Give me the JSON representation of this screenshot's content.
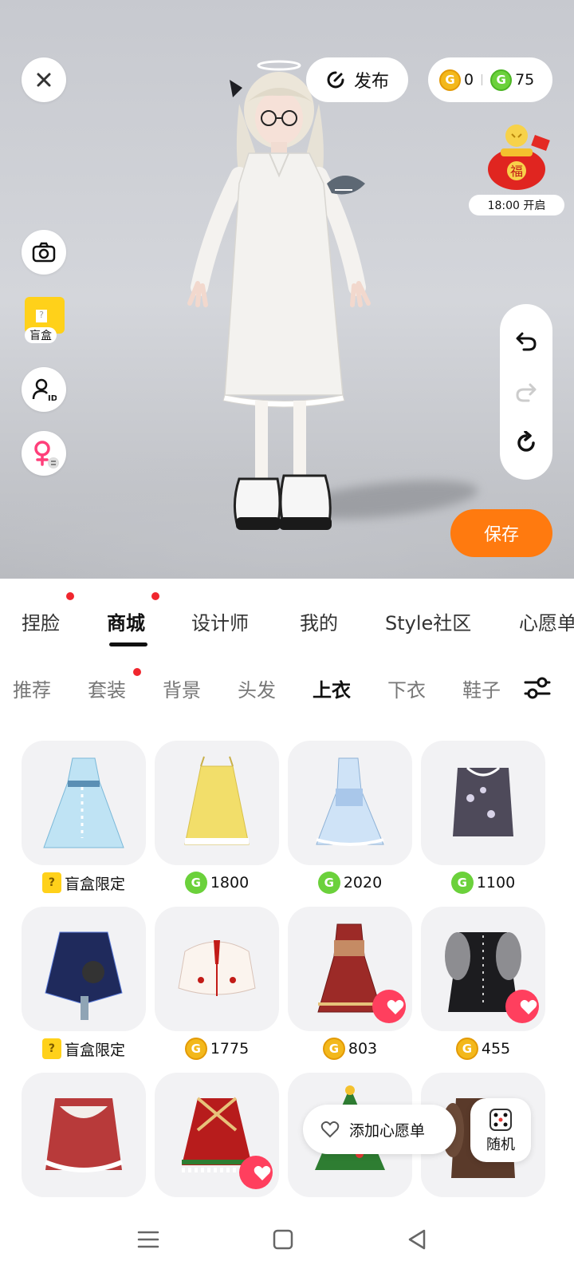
{
  "top": {
    "publish_label": "发布",
    "wallet": {
      "gold_coins": "0",
      "green_coins": "75"
    },
    "event_time": "18:00 开启",
    "blind_box_label": "盲盒",
    "save_label": "保存"
  },
  "main_tabs": [
    {
      "label": "捏脸",
      "dot": true
    },
    {
      "label": "商城",
      "dot": true,
      "active": true
    },
    {
      "label": "设计师"
    },
    {
      "label": "我的"
    },
    {
      "label": "Style社区"
    },
    {
      "label": "心愿单"
    }
  ],
  "sub_tabs": [
    {
      "label": "推荐"
    },
    {
      "label": "套装",
      "dot": true
    },
    {
      "label": "背景"
    },
    {
      "label": "头发"
    },
    {
      "label": "上衣",
      "active": true
    },
    {
      "label": "下衣"
    },
    {
      "label": "鞋子"
    }
  ],
  "items": [
    {
      "price": "盲盒限定",
      "currency": "blindbox"
    },
    {
      "price": "1800",
      "currency": "green"
    },
    {
      "price": "2020",
      "currency": "green"
    },
    {
      "price": "1100",
      "currency": "green"
    },
    {
      "price": "盲盒限定",
      "currency": "blindbox"
    },
    {
      "price": "1775",
      "currency": "gold"
    },
    {
      "price": "803",
      "currency": "gold",
      "favorited": true
    },
    {
      "price": "455",
      "currency": "gold",
      "favorited": true
    },
    {
      "price": "",
      "currency": ""
    },
    {
      "price": "",
      "currency": "",
      "favorited": true
    },
    {
      "price": "",
      "currency": ""
    },
    {
      "price": "",
      "currency": ""
    }
  ],
  "floating": {
    "wishlist_label": "添加心愿单",
    "random_label": "随机"
  },
  "colors": {
    "accent_orange": "#ff7a0f",
    "favorite_red": "#ff3f5e",
    "green_coin": "#6bd13b",
    "gold_coin": "#f3b81b"
  }
}
